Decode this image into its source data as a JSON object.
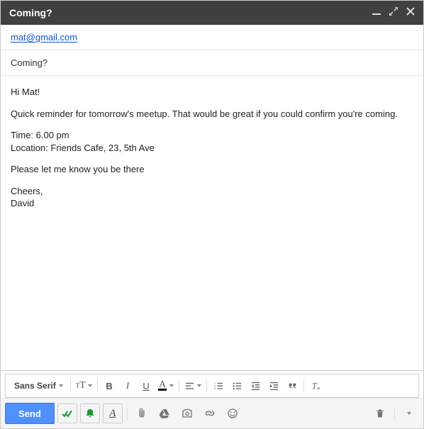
{
  "header": {
    "title": "Coming?"
  },
  "to": {
    "address": "mat@gmail.com"
  },
  "subject": {
    "text": "Coming?"
  },
  "body": {
    "p1": "Hi Mat!",
    "p2": "Quick reminder for tomorrow's meetup. That would be great if you could confirm you're coming.",
    "p3a": "Time: 6.00 pm",
    "p3b": "Location: Friends Cafe, 23, 5th Ave",
    "p4": "Please let me know you be there",
    "p5a": "Cheers,",
    "p5b": "David"
  },
  "formatbar": {
    "font": "Sans Serif",
    "bold": "B",
    "italic": "I",
    "underline": "U",
    "color": "A"
  },
  "bottombar": {
    "send": "Send",
    "a_underline": "A"
  }
}
